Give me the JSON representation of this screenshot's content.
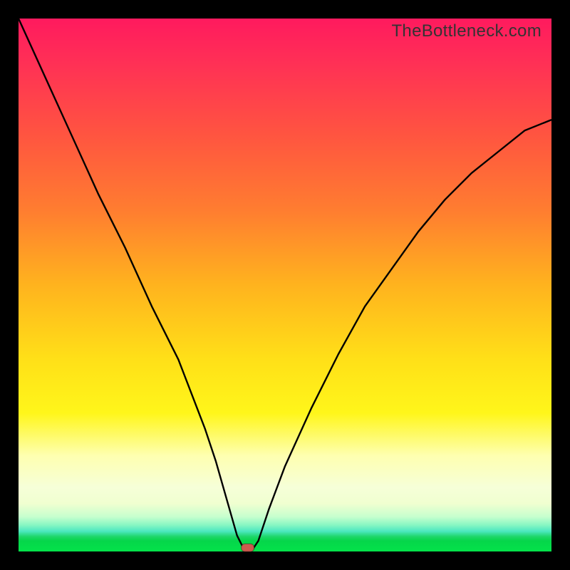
{
  "watermark": "TheBottleneck.com",
  "chart_data": {
    "type": "line",
    "title": "",
    "xlabel": "",
    "ylabel": "",
    "xlim": [
      0,
      100
    ],
    "ylim": [
      0,
      100
    ],
    "legend": false,
    "grid": false,
    "series": [
      {
        "name": "curve",
        "x": [
          0,
          5,
          10,
          15,
          20,
          25,
          30,
          35,
          37,
          39,
          41,
          42,
          43,
          44,
          45,
          47,
          50,
          55,
          60,
          65,
          70,
          75,
          80,
          85,
          90,
          95,
          100
        ],
        "y": [
          100,
          89,
          78,
          67,
          57,
          46,
          36,
          23,
          17,
          10,
          3,
          1,
          0.5,
          0.5,
          2,
          8,
          16,
          27,
          37,
          46,
          53,
          60,
          66,
          71,
          75,
          79,
          81
        ]
      }
    ],
    "annotations": [
      {
        "type": "marker",
        "shape": "rounded-rect",
        "x": 43,
        "y": 0.7,
        "color": "#cc5a4e"
      }
    ],
    "background_gradient_stops": [
      {
        "pos": 0.0,
        "color": "#ff1a5e"
      },
      {
        "pos": 0.5,
        "color": "#ffb31e"
      },
      {
        "pos": 0.74,
        "color": "#fff61a"
      },
      {
        "pos": 0.95,
        "color": "#4ce8c0"
      },
      {
        "pos": 1.0,
        "color": "#04e24a"
      }
    ]
  }
}
